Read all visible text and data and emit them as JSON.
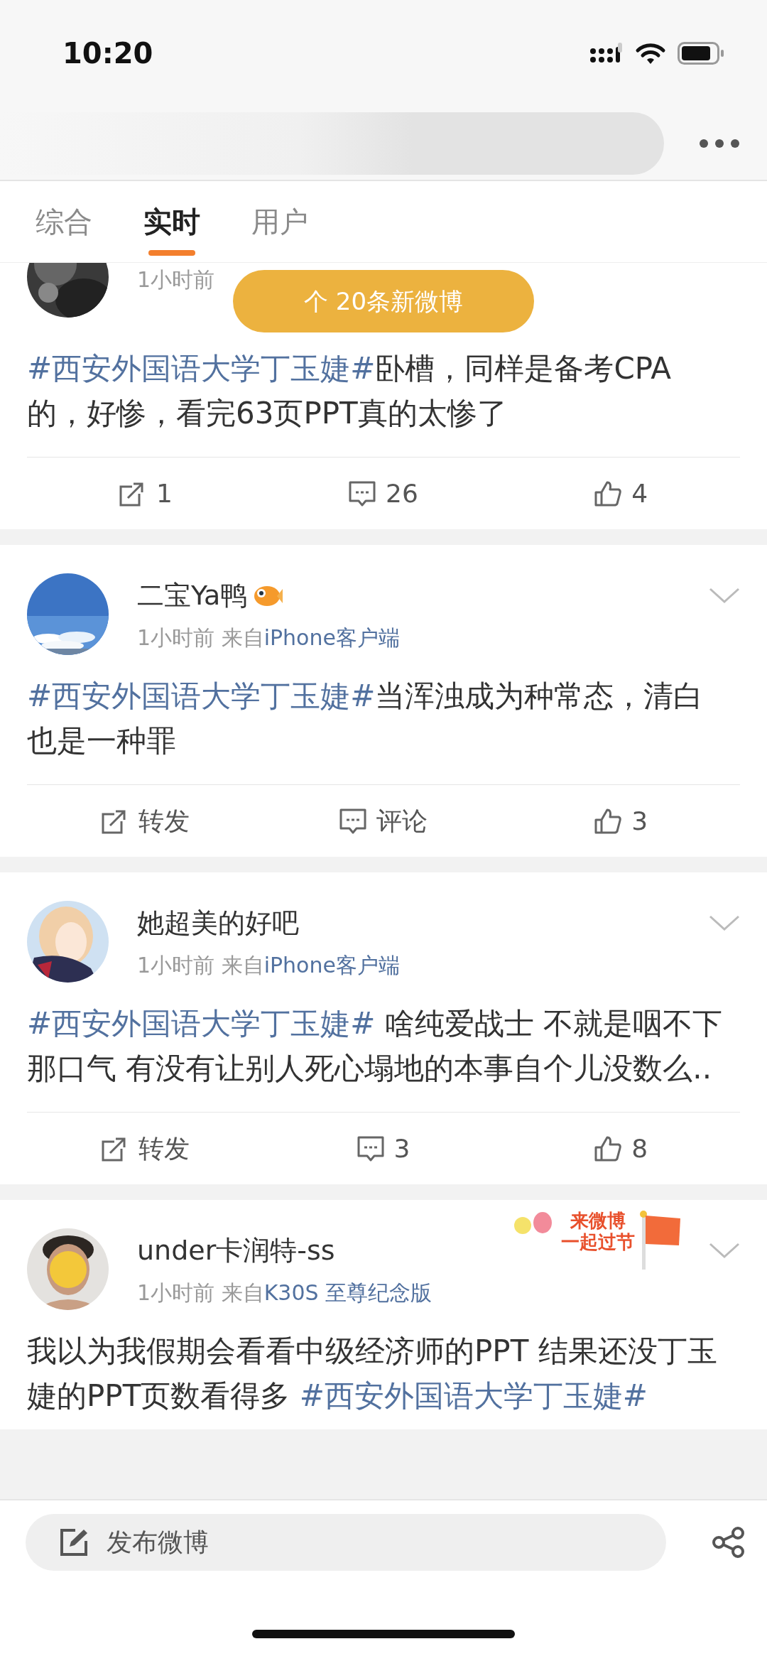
{
  "status_bar": {
    "time": "10:20"
  },
  "tabs": [
    {
      "label": "综合",
      "selected": false
    },
    {
      "label": "实时",
      "selected": true
    },
    {
      "label": "用户",
      "selected": false
    }
  ],
  "new_posts_notice": "个 20条新微博",
  "posts": [
    {
      "time": "1小时前",
      "menu": false,
      "content": [
        {
          "kind": "topic",
          "text": "#西安外国语大学丁玉婕#"
        },
        {
          "kind": "plain",
          "text": "卧槽，同样是备考CPA的，好惨，看完63页PPT真的太惨了"
        }
      ],
      "actions": [
        "1",
        "26",
        "4"
      ]
    },
    {
      "name": "二宝Ya鸭",
      "badge": true,
      "time": "1小时前",
      "source_prefix": "来自",
      "source": "iPhone客户端",
      "menu": true,
      "content": [
        {
          "kind": "topic",
          "text": "#西安外国语大学丁玉婕#"
        },
        {
          "kind": "plain",
          "text": "当浑浊成为种常态，清白也是一种罪"
        }
      ],
      "actions": [
        "转发",
        "评论",
        "3"
      ]
    },
    {
      "name": "她超美的好吧",
      "badge": false,
      "time": "1小时前",
      "source_prefix": "来自",
      "source": "iPhone客户端",
      "menu": true,
      "content": [
        {
          "kind": "topic",
          "text": "#西安外国语大学丁玉婕#"
        },
        {
          "kind": "plain",
          "text": " 啥纯爱战士 不就是咽不下那口气 有没有让别人死心塌地的本事自个儿没数么.."
        }
      ],
      "actions": [
        "转发",
        "3",
        "8"
      ]
    },
    {
      "name": "under卡润特-ss",
      "badge": false,
      "time": "1小时前",
      "source_prefix": "来自",
      "source": "K30S 至尊纪念版",
      "menu": true,
      "sticker": [
        "来微博",
        "一起过节"
      ],
      "content": [
        {
          "kind": "plain",
          "text": "我以为我假期会看看中级经济师的PPT 结果还没丁玉婕的PPT页数看得多 "
        },
        {
          "kind": "topic",
          "text": "#西安外国语大学丁玉婕#"
        }
      ]
    }
  ],
  "compose": {
    "label": "发布微博"
  }
}
